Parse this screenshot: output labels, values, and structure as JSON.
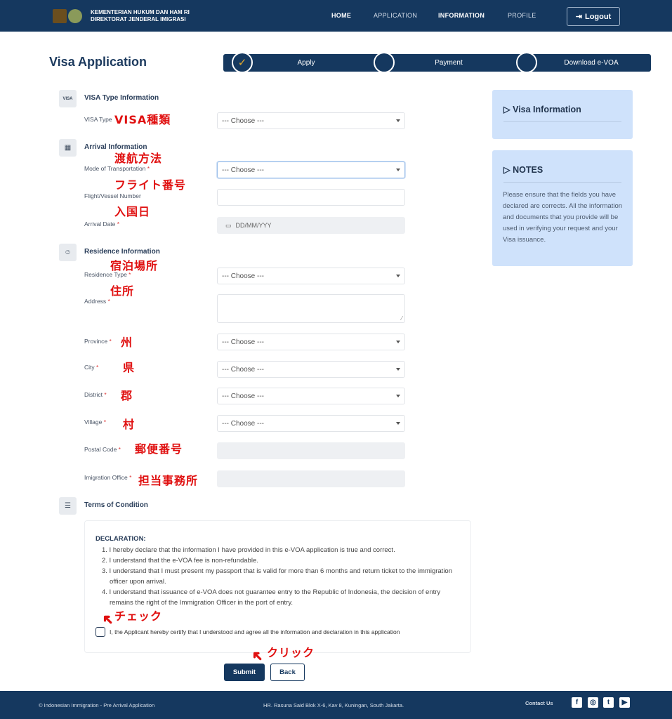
{
  "header": {
    "brand_line1": "KEMENTERIAN HUKUM DAN HAM RI",
    "brand_line2": "DIREKTORAT JENDERAL IMIGRASI",
    "nav": [
      "HOME",
      "APPLICATION",
      "INFORMATION",
      "PROFILE"
    ],
    "logout": "Logout"
  },
  "page_title": "Visa Application",
  "steps": [
    {
      "label": "Apply",
      "done": true
    },
    {
      "label": "Payment",
      "done": false
    },
    {
      "label": "Download e-VOA",
      "done": false
    }
  ],
  "sections": [
    {
      "title": "VISA Type Information",
      "icon": "visa-card-icon"
    },
    {
      "title": "Arrival Information",
      "icon": "calendar-icon"
    },
    {
      "title": "Residence Information",
      "icon": "user-badge-icon"
    },
    {
      "title": "Terms of Condition",
      "icon": "list-icon"
    }
  ],
  "fields": [
    {
      "label": "VISA Type",
      "required": false,
      "type": "select",
      "value": "--- Choose ---",
      "note": "VISA種類"
    },
    {
      "label": "Mode of Transportation",
      "required": true,
      "type": "select",
      "value": "--- Choose ---",
      "note": "渡航方法",
      "focused": true
    },
    {
      "label": "Flight/Vessel Number",
      "required": false,
      "type": "text",
      "value": "",
      "note": "フライト番号"
    },
    {
      "label": "Arrival Date",
      "required": true,
      "type": "date",
      "placeholder": "DD/MM/YYY",
      "note": "入国日"
    },
    {
      "label": "Residence Type",
      "required": true,
      "type": "select",
      "value": "--- Choose ---",
      "note": "宿泊場所"
    },
    {
      "label": "Address",
      "required": true,
      "type": "textarea",
      "value": "",
      "note": "住所"
    },
    {
      "label": "Province",
      "required": true,
      "type": "select",
      "value": "--- Choose ---",
      "note": "州"
    },
    {
      "label": "City",
      "required": true,
      "type": "select",
      "value": "--- Choose ---",
      "note": "県"
    },
    {
      "label": "District",
      "required": true,
      "type": "select",
      "value": "--- Choose ---",
      "note": "郡"
    },
    {
      "label": "Village",
      "required": true,
      "type": "select",
      "value": "--- Choose ---",
      "note": "村"
    },
    {
      "label": "Postal Code",
      "required": true,
      "type": "readonly",
      "value": "",
      "note": "郵便番号"
    },
    {
      "label": "Imigration Office",
      "required": true,
      "type": "readonly",
      "value": "",
      "note": "担当事務所"
    }
  ],
  "visa_info": {
    "title": "Visa Information"
  },
  "notes": {
    "title": "NOTES",
    "text": "Please ensure that the fields you have declared are corrects. All the information and documents that you provide will be used in verifying your request and your Visa issuance."
  },
  "terms": {
    "heading": "DECLARATION:",
    "items": [
      "1. I hereby declare that the information I have provided in this e-VOA application is true and correct.",
      "2. I understand that the e-VOA fee is non-refundable.",
      "3. I understand that I must present my passport that is valid for more than 6 months and return ticket to the immigration officer upon arrival.",
      "4. I understand that issuance of e-VOA does not guarantee entry to the Republic of Indonesia, the decision of entry remains the right of the Immigration Officer in the port of entry."
    ],
    "checkbox_label": "I, the Applicant hereby certify that I understood and agree all the information and declaration in this application",
    "checked": false,
    "check_note": "チェック"
  },
  "actions": {
    "submit": "Submit",
    "back": "Back",
    "click_note": "クリック"
  },
  "footer": {
    "copyright": "© Indonesian Immigration - Pre Arrival Application",
    "address": "HR. Rasuna Said Blok X-6, Kav 8, Kuningan, South Jakarta.",
    "contact": "Contact Us",
    "social": [
      "facebook-icon",
      "instagram-icon",
      "twitter-icon",
      "youtube-icon"
    ]
  },
  "colors": {
    "primary": "#15385f",
    "panel": "#cfe2fb",
    "annotation": "#e01010",
    "step_check": "#e0a92e"
  }
}
